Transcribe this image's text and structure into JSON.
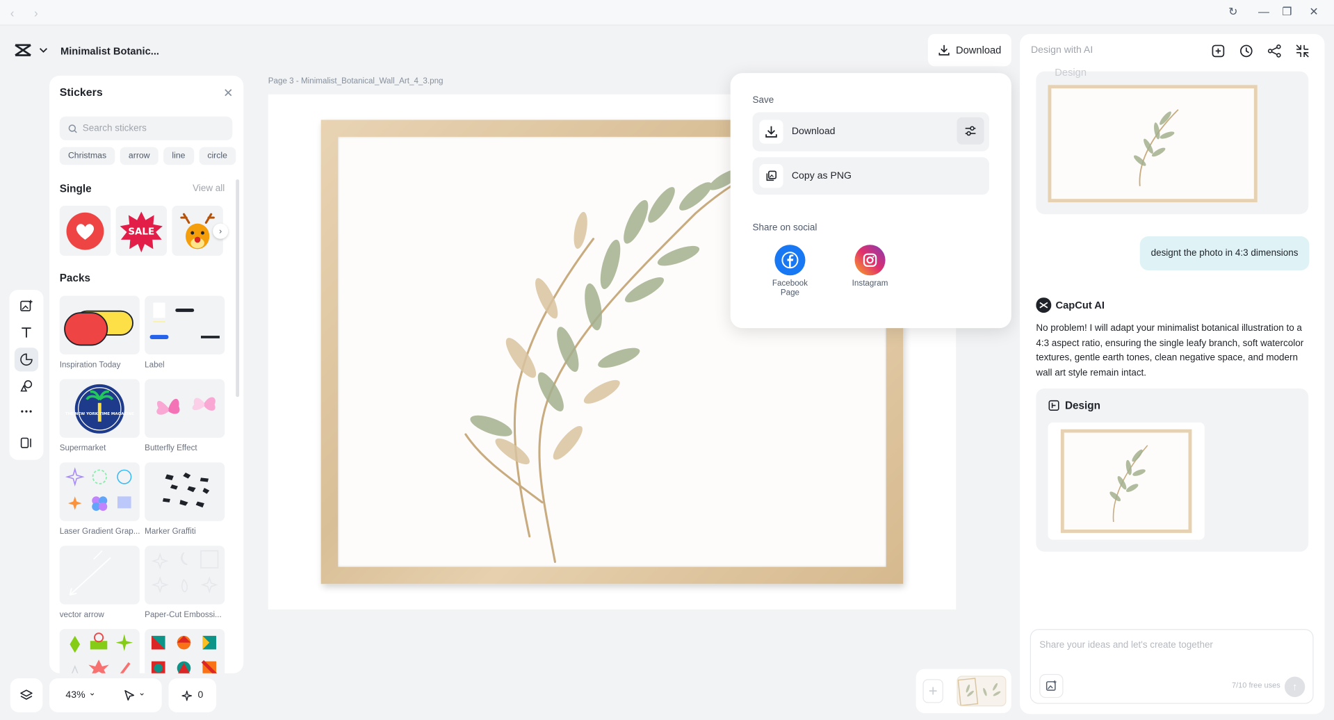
{
  "window": {
    "refresh": "↻",
    "minimize": "—",
    "maximize": "❐",
    "close": "✕"
  },
  "header": {
    "doc_title": "Minimalist Botanic...",
    "download_label": "Download"
  },
  "stickers": {
    "title": "Stickers",
    "search_placeholder": "Search stickers",
    "chips": [
      "Christmas",
      "arrow",
      "line",
      "circle"
    ],
    "single_title": "Single",
    "view_all": "View all",
    "single_items": [
      "heart-sticker",
      "sale-sticker",
      "reindeer-sticker"
    ],
    "sale_text": "SALE",
    "packs_title": "Packs",
    "magazine_text": "THE NEW YORK TIME MAGAZINE",
    "packs": [
      "Inspiration Today",
      "Label",
      "Supermarket",
      "Butterfly Effect",
      "Laser Gradient Grap...",
      "Marker Graffiti",
      "vector arrow",
      "Paper-Cut Embossi..."
    ]
  },
  "canvas": {
    "page_label": "Page 3 -  Minimalist_Botanical_Wall_Art_4_3.png"
  },
  "popup": {
    "save_label": "Save",
    "download_label": "Download",
    "copy_label": "Copy as PNG",
    "share_label": "Share on social",
    "facebook_label": "Facebook Page",
    "instagram_label": "Instagram"
  },
  "ai": {
    "title": "Design with AI",
    "faded_design": "Design",
    "user_message": "designt the photo in 4:3 dimensions",
    "bot_name": "CapCut AI",
    "bot_message": "No problem! I will adapt your minimalist botanical illustration to a 4:3 aspect ratio, ensuring the single leafy branch, soft watercolor textures, gentle earth tones, clean negative space, and modern wall art style remain intact.",
    "design_label": "Design",
    "input_placeholder": "Share your ideas and let's create together",
    "free_uses": "7/10 free uses"
  },
  "bottom": {
    "zoom": "43%",
    "zoom_caret": "⌄",
    "pointer_caret": "⌄",
    "ai_count": "0"
  },
  "colors": {
    "accent": "#1f2329",
    "user_bubble": "#dff2f5",
    "facebook": "#1877f2",
    "frame": "#dcc39d"
  }
}
